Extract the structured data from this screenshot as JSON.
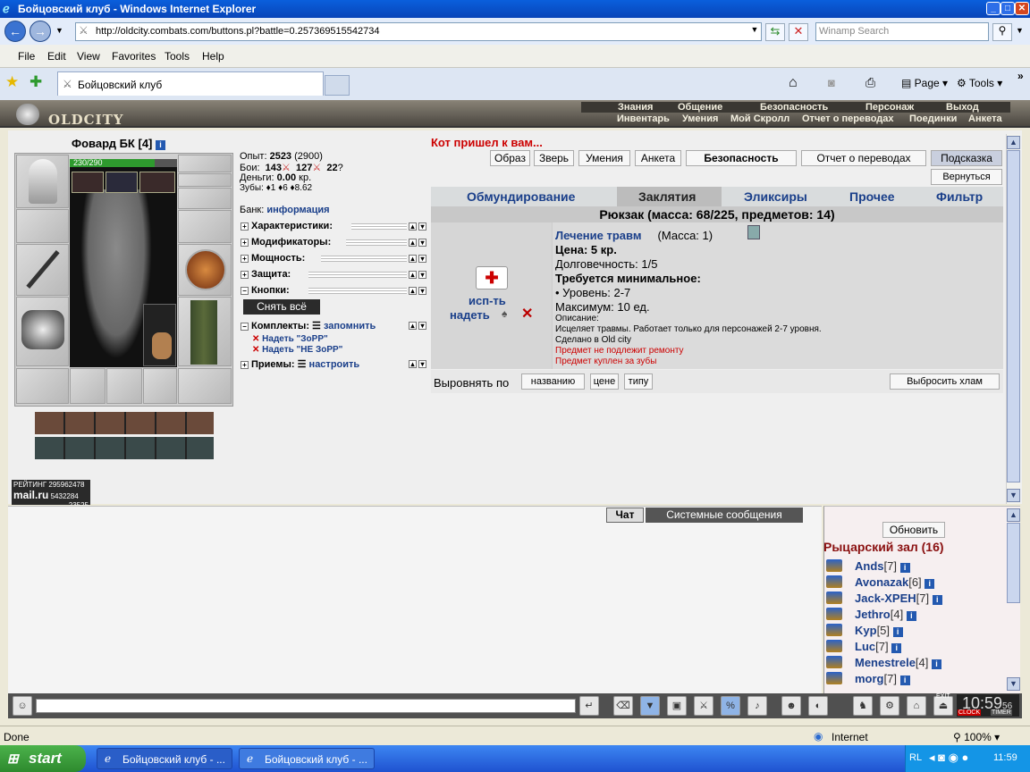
{
  "window": {
    "title": "Бойцовский клуб - Windows Internet Explorer"
  },
  "address": {
    "url": "http://oldcity.combats.com/buttons.pl?battle=0.257369515542734",
    "search_placeholder": "Winamp Search"
  },
  "menu": [
    "File",
    "Edit",
    "View",
    "Favorites",
    "Tools",
    "Help"
  ],
  "tab": {
    "title": "Бойцовский клуб"
  },
  "ietools": {
    "page": "Page",
    "tools": "Tools"
  },
  "game": {
    "logo": "OLDCITY",
    "nav_top": [
      "Знания",
      "Общение",
      "Безопасность",
      "Персонаж",
      "Выход"
    ],
    "nav_bottom": [
      "Инвентарь",
      "Умения",
      "Мой Скролл",
      "Отчет о переводах",
      "Поединки",
      "Анкета"
    ]
  },
  "character": {
    "name": "Фовард БК",
    "level": "[4]",
    "hp": "230/290",
    "hp_fraction": 0.79
  },
  "stats": {
    "exp_label": "Опыт:",
    "exp": "2523",
    "exp_next": "(2900)",
    "fights_label": "Бои:",
    "wins": "143",
    "losses": "127",
    "draws": "22",
    "money_label": "Деньги:",
    "money": "0.00",
    "money_unit": "кр.",
    "teeth_label": "Зубы:",
    "teeth": "1",
    "teeth2": "6",
    "teeth3": "8.62",
    "bank_label": "Банк:",
    "bank_link": "информация"
  },
  "groups": [
    "Характеристики:",
    "Модификаторы:",
    "Мощность:",
    "Защита:",
    "Кнопки:"
  ],
  "takeoff_all": "Снять всё",
  "sets": {
    "label": "Комплекты:",
    "remember": "запомнить",
    "items": [
      "Надеть \"ЗоРР\"",
      "Надеть \"НЕ ЗоРР\""
    ]
  },
  "techniques": {
    "label": "Приемы:",
    "setup": "настроить"
  },
  "notice": "Кот пришел к вам...",
  "top_buttons": [
    "Образ",
    "Зверь",
    "Умения",
    "Анкета",
    "Безопасность",
    "Отчет о переводах",
    "Подсказка"
  ],
  "back_button": "Вернуться",
  "inv_tabs": [
    "Обмундирование",
    "Заклятия",
    "Эликсиры",
    "Прочее",
    "Фильтр"
  ],
  "backpack_title": "Рюкзак (масса: 68/225, предметов: 14)",
  "item": {
    "use_label": "исп-ть",
    "wear_label": "надеть",
    "name": "Лечение травм",
    "mass": "(Масса: 1)",
    "price": "Цена: 5 кр.",
    "durability": "Долговечность: 1/5",
    "req_title": "Требуется минимальное:",
    "req_level": "• Уровень: 2-7",
    "max": "Максимум: 10 ед.",
    "desc_label": "Описание:",
    "desc": "Исцеляет травмы. Работает только для персонажей 2-7 уровня.",
    "made": "Сделано в Old city",
    "note1": "Предмет не подлежит ремонту",
    "note2": "Предмет куплен за зубы"
  },
  "sort": {
    "label": "Выровнять по",
    "options": [
      "названию",
      "цене",
      "типу"
    ],
    "trash": "Выбросить хлам"
  },
  "rating": {
    "label": "РЕЙТИНГ",
    "v1": "295962478",
    "brand": "mail.ru",
    "v2": "5432284",
    "v3": "23525"
  },
  "chat": {
    "tab1": "Чат",
    "tab2": "Системные сообщения"
  },
  "online": {
    "refresh": "Обновить",
    "room": "Рыцарский зал (16)",
    "users": [
      {
        "name": "Ands",
        "level": "[7]"
      },
      {
        "name": "Avonazak",
        "level": "[6]"
      },
      {
        "name": "Jack-XPEH",
        "level": "[7]"
      },
      {
        "name": "Jethro",
        "level": "[4]"
      },
      {
        "name": "Kyp",
        "level": "[5]"
      },
      {
        "name": "Luc",
        "level": "[7]"
      },
      {
        "name": "Menestrele",
        "level": "[4]"
      },
      {
        "name": "morg",
        "level": "[7]"
      }
    ]
  },
  "clock": {
    "time": "10:59",
    "sec": "56",
    "label1": "CLOCK",
    "label2": "TIMER",
    "exit": "EXIT"
  },
  "status": {
    "text": "Done",
    "zone": "Internet",
    "zoom": "100%"
  },
  "taskbar": {
    "start": "start",
    "tasks": [
      "Бойцовский клуб - ...",
      "Бойцовский клуб - ..."
    ],
    "lang": "RL",
    "time": "11:59"
  }
}
